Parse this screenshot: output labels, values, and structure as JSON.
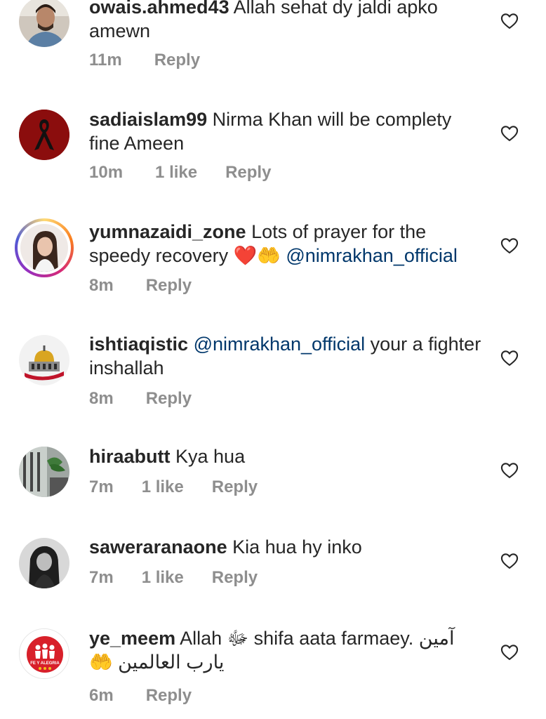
{
  "comments": [
    {
      "username": "owais.ahmed43",
      "text": " Allah sehat dy jaldi apko amewn",
      "time": "11m",
      "likes": "",
      "reply": "Reply",
      "avatar_icon": "man-portrait-avatar"
    },
    {
      "username": "sadiaislam99",
      "text": " Nirma Khan will be complety fine Ameen",
      "time": "10m",
      "likes": "1 like",
      "reply": "Reply",
      "avatar_icon": "black-ribbon-avatar"
    },
    {
      "username": "yumnazaidi_zone",
      "text_before": " Lots of prayer for the speedy recovery ❤️🤲 ",
      "mention": "@nimrakhan_official",
      "time": "8m",
      "likes": "",
      "reply": "Reply",
      "avatar_icon": "woman-portrait-avatar-story-ring"
    },
    {
      "username": "ishtiaqistic",
      "mention": "@nimrakhan_official",
      "text_after": " your a fighter inshallah",
      "time": "8m",
      "likes": "",
      "reply": "Reply",
      "avatar_icon": "dome-of-rock-avatar"
    },
    {
      "username": "hiraabutt",
      "text": " Kya hua",
      "time": "7m",
      "likes": "1 like",
      "reply": "Reply",
      "avatar_icon": "room-interior-avatar"
    },
    {
      "username": "saweraranaone",
      "text": " Kia hua hy inko",
      "time": "7m",
      "likes": "1 like",
      "reply": "Reply",
      "avatar_icon": "woman-bw-portrait-avatar"
    },
    {
      "username": "ye_meem",
      "text_before": " Allah ﷻ shifa aata farmaey. ",
      "arabic_1": "آمین",
      "emoji": " 🤲 ",
      "arabic_2": "یارب العالمین",
      "logo_text": "FE Y ALEGRIA",
      "time": "6m",
      "likes": "",
      "reply": "Reply",
      "avatar_icon": "fe-y-alegria-logo-avatar"
    }
  ],
  "colors": {
    "text": "#262626",
    "meta": "#8e8e8e",
    "mention": "#00376b",
    "heart_outline": "#262626"
  },
  "icons": {
    "like": "heart-outline-icon"
  }
}
